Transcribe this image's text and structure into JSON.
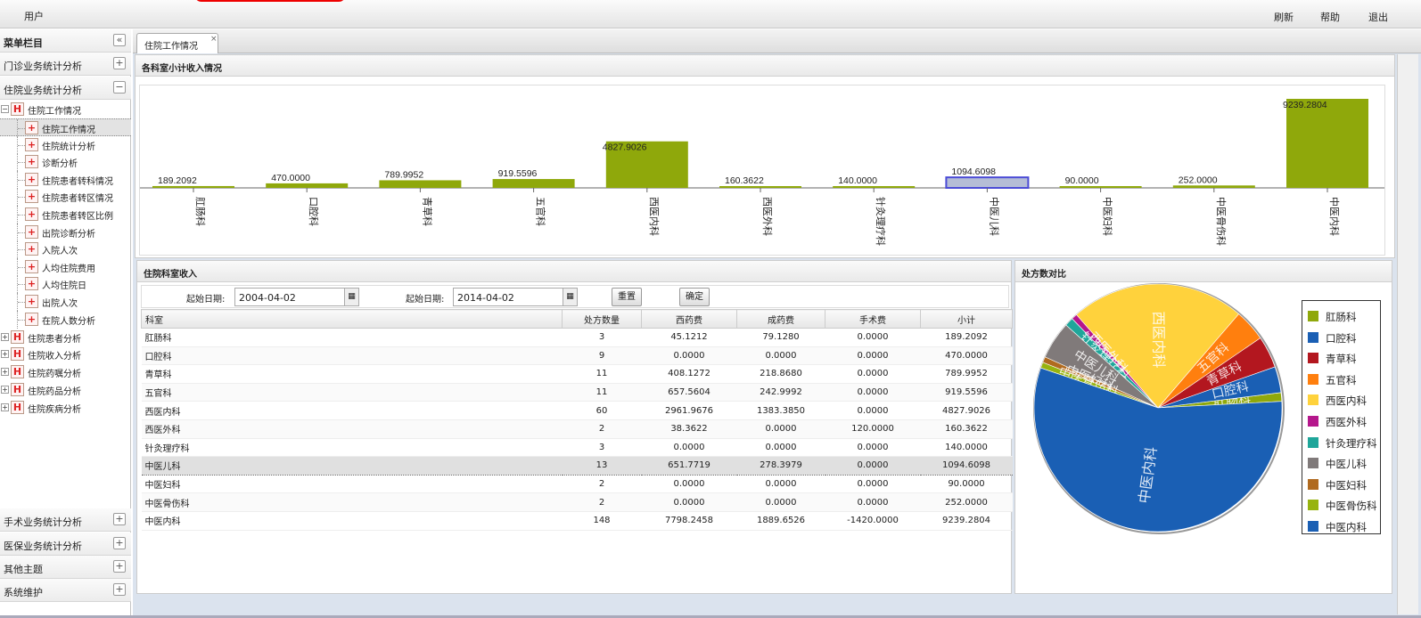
{
  "topbar": {
    "user_label": "用户",
    "refresh": "刷新",
    "help": "帮助",
    "logout": "退出"
  },
  "sidebar": {
    "header": "菜单栏目",
    "collapse_icon": "«",
    "sections": [
      {
        "label": "门诊业务统计分析",
        "icon": "+"
      },
      {
        "label": "住院业务统计分析",
        "icon": "−"
      }
    ],
    "tree": {
      "root": "住院工作情况",
      "children": [
        "住院工作情况",
        "住院统计分析",
        "诊断分析",
        "住院患者转科情况",
        "住院患者转区情况",
        "住院患者转区比例",
        "出院诊断分析",
        "入院人次",
        "人均住院费用",
        "人均住院日",
        "出院人次",
        "在院人数分析"
      ],
      "others": [
        "住院患者分析",
        "住院收入分析",
        "住院药嘱分析",
        "住院药品分析",
        "住院疾病分析"
      ]
    },
    "bottom_sections": [
      "手术业务统计分析",
      "医保业务统计分析",
      "其他主题",
      "系统维护"
    ]
  },
  "tab": {
    "label": "住院工作情况",
    "close": "×"
  },
  "chart_panel": {
    "title": "各科室小计收入情况"
  },
  "grid_panel": {
    "title": "住院科室收入",
    "start_label": "起始日期:",
    "start_value": "2004-04-02",
    "end_label": "起始日期:",
    "end_value": "2014-04-02",
    "reset": "重置",
    "ok": "确定",
    "columns": [
      "科室",
      "处方数量",
      "西药费",
      "成药费",
      "手术费",
      "小计"
    ],
    "rows": [
      [
        "肛肠科",
        "3",
        "45.1212",
        "79.1280",
        "0.0000",
        "189.2092"
      ],
      [
        "口腔科",
        "9",
        "0.0000",
        "0.0000",
        "0.0000",
        "470.0000"
      ],
      [
        "青草科",
        "11",
        "408.1272",
        "218.8680",
        "0.0000",
        "789.9952"
      ],
      [
        "五官科",
        "11",
        "657.5604",
        "242.9992",
        "0.0000",
        "919.5596"
      ],
      [
        "西医内科",
        "60",
        "2961.9676",
        "1383.3850",
        "0.0000",
        "4827.9026"
      ],
      [
        "西医外科",
        "2",
        "38.3622",
        "0.0000",
        "120.0000",
        "160.3622"
      ],
      [
        "针灸理疗科",
        "3",
        "0.0000",
        "0.0000",
        "0.0000",
        "140.0000"
      ],
      [
        "中医儿科",
        "13",
        "651.7719",
        "278.3979",
        "0.0000",
        "1094.6098"
      ],
      [
        "中医妇科",
        "2",
        "0.0000",
        "0.0000",
        "0.0000",
        "90.0000"
      ],
      [
        "中医骨伤科",
        "2",
        "0.0000",
        "0.0000",
        "0.0000",
        "252.0000"
      ],
      [
        "中医内科",
        "148",
        "7798.2458",
        "1889.6526",
        "-1420.0000",
        "9239.2804"
      ]
    ],
    "selected_row": 7
  },
  "pie_panel": {
    "title": "处方数对比"
  },
  "chart_data": [
    {
      "type": "bar",
      "title": "各科室小计收入情况",
      "categories": [
        "肛肠科",
        "口腔科",
        "青草科",
        "五官科",
        "西医内科",
        "西医外科",
        "针灸理疗科",
        "中医儿科",
        "中医妇科",
        "中医骨伤科",
        "中医内科"
      ],
      "values": [
        189.2092,
        470.0,
        789.9952,
        919.5596,
        4827.9026,
        160.3622,
        140.0,
        1094.6098,
        90.0,
        252.0,
        9239.2804
      ],
      "labels": [
        "189.2092",
        "470.0000",
        "789.9952",
        "919.5596",
        "4827.9026",
        "160.3622",
        "140.0000",
        "1094.6098",
        "90.0000",
        "252.0000",
        "9239.2804"
      ],
      "highlighted": 7,
      "ylim": [
        0,
        9239.2804
      ],
      "color": "#8fa80b",
      "highlight_color": "#b5bdd6"
    },
    {
      "type": "pie",
      "title": "处方数对比",
      "categories": [
        "肛肠科",
        "口腔科",
        "青草科",
        "五官科",
        "西医内科",
        "西医外科",
        "针灸理疗科",
        "中医儿科",
        "中医妇科",
        "中医骨伤科",
        "中医内科"
      ],
      "values": [
        3,
        9,
        11,
        11,
        60,
        2,
        3,
        13,
        2,
        2,
        148
      ],
      "colors": [
        "#8fa80b",
        "#1a5fb4",
        "#b3171f",
        "#ff7f0e",
        "#ffd23c",
        "#b5178c",
        "#1fa69a",
        "#807a7a",
        "#b06a1f",
        "#97b30f",
        "#1a5fb4"
      ]
    }
  ]
}
